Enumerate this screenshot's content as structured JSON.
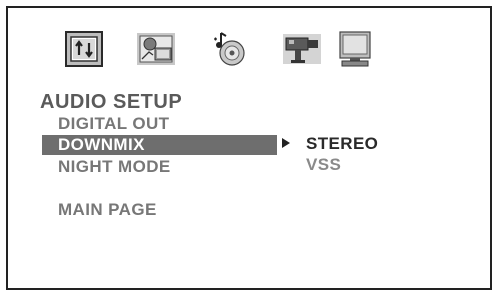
{
  "menu": {
    "title": "AUDIO SETUP",
    "items": [
      {
        "label": "DIGITAL OUT",
        "active": false
      },
      {
        "label": "DOWNMIX",
        "active": true
      },
      {
        "label": "NIGHT MODE",
        "active": false
      }
    ],
    "main_page_label": "MAIN PAGE"
  },
  "submenu": {
    "options": [
      {
        "label": "STEREO",
        "selected": true
      },
      {
        "label": "VSS",
        "selected": false
      }
    ]
  },
  "icons": [
    {
      "name": "general-setup-icon",
      "selected": true
    },
    {
      "name": "video-setup-icon",
      "selected": false
    },
    {
      "name": "audio-setup-icon",
      "selected": false
    },
    {
      "name": "preference-icon",
      "selected": false
    },
    {
      "name": "monitor-icon",
      "selected": false
    }
  ]
}
